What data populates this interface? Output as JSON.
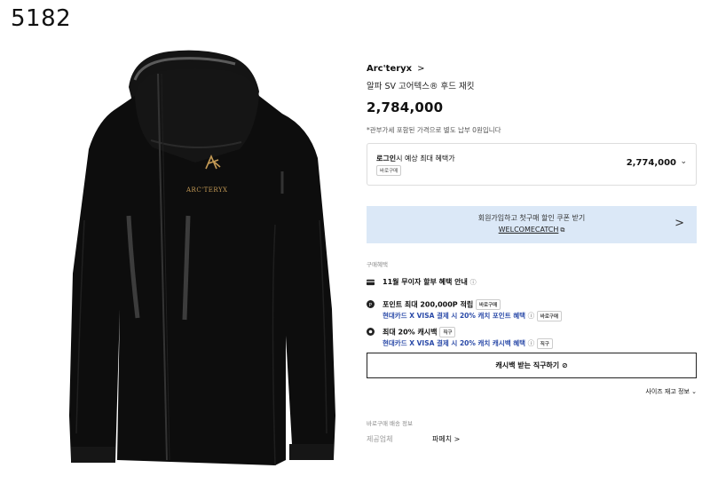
{
  "code_label": "5182",
  "product": {
    "brand": "Arc'teryx",
    "brand_chevron": ">",
    "name": "알파 SV 고어텍스® 후드 재킷",
    "price": "2,784,000",
    "tax_note": "*관부가세 포함된 가격으로 별도 납부 0원입니다",
    "logo_text": "ARC'TERYX"
  },
  "login_box": {
    "title_bold": "로그인",
    "title_rest": "시 예상 최대 혜택가",
    "tag": "바로구매",
    "price": "2,774,000",
    "chevron": "⌄"
  },
  "coupon": {
    "line1": "회원가입하고 첫구매 할인 쿠폰 받기",
    "code": "WELCOMECATCH",
    "copy_icon": "⧉",
    "chevron": ">"
  },
  "benefits_label": "구매혜택",
  "benefits": {
    "installment": "11월 무이자 할부 혜택 안내",
    "info_icon": "ⓘ",
    "points_title": "포인트 최대 200,000P 적립",
    "points_tag": "바로구매",
    "points_sub": "현대카드 X VISA 결제 시 20% 캐치 포인트 혜택",
    "points_sub_tag": "바로구매",
    "cashback_title": "최대 20% 캐시백",
    "cashback_tag": "직구",
    "cashback_sub": "현대카드 X VISA 결제 시 20% 캐치 캐시백 혜택",
    "cashback_sub_tag": "직구"
  },
  "cashback_button": "캐시백 받는 직구하기 ⊘",
  "size_info": "사이즈 재고 정보 ⌄",
  "delivery_label": "바로구매 배송 정보",
  "supplier": {
    "key": "제공업체",
    "value": "파페치 >"
  },
  "colors": {
    "coupon_bg": "#dbe8f7",
    "link_blue": "#2a4aa8",
    "jacket": "#0d0d0d"
  }
}
